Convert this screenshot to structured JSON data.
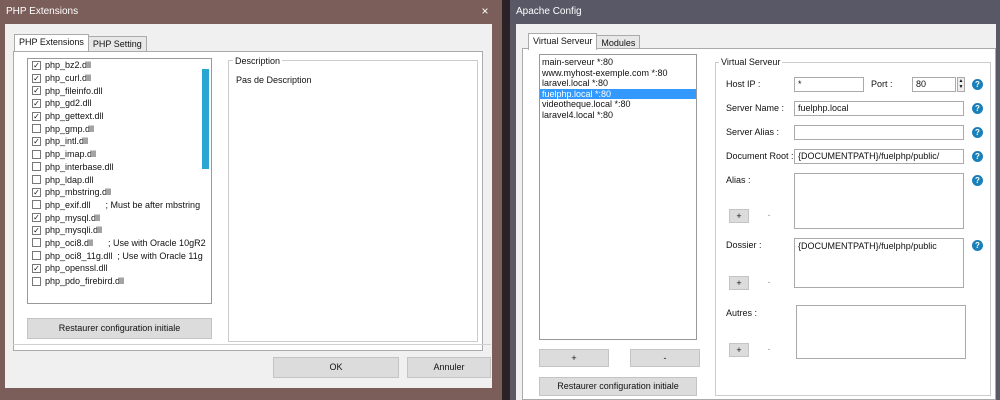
{
  "left_window": {
    "title": "PHP Extensions",
    "close_glyph": "×",
    "tabs": [
      {
        "label": "PHP Extensions",
        "active": true
      },
      {
        "label": "PHP Setting",
        "active": false
      }
    ],
    "extensions": [
      {
        "name": "php_bz2.dll",
        "checked": true
      },
      {
        "name": "php_curl.dll",
        "checked": true
      },
      {
        "name": "php_fileinfo.dll",
        "checked": true
      },
      {
        "name": "php_gd2.dll",
        "checked": true
      },
      {
        "name": "php_gettext.dll",
        "checked": true
      },
      {
        "name": "php_gmp.dll",
        "checked": false
      },
      {
        "name": "php_intl.dll",
        "checked": true
      },
      {
        "name": "php_imap.dll",
        "checked": false
      },
      {
        "name": "php_interbase.dll",
        "checked": false
      },
      {
        "name": "php_ldap.dll",
        "checked": false
      },
      {
        "name": "php_mbstring.dll",
        "checked": true
      },
      {
        "name": "php_exif.dll      ; Must be after mbstring",
        "checked": false
      },
      {
        "name": "php_mysql.dll",
        "checked": true
      },
      {
        "name": "php_mysqli.dll",
        "checked": true
      },
      {
        "name": "php_oci8.dll      ; Use with Oracle 10gR2",
        "checked": false
      },
      {
        "name": "php_oci8_11g.dll  ; Use with Oracle 11g",
        "checked": false
      },
      {
        "name": "php_openssl.dll",
        "checked": true
      },
      {
        "name": "php_pdo_firebird.dll",
        "checked": false
      }
    ],
    "description_label": "Description",
    "description_text": "Pas de Description",
    "restore_button": "Restaurer configuration initiale",
    "ok_button": "OK",
    "cancel_button": "Annuler"
  },
  "right_window": {
    "title": "Apache Config",
    "tabs": [
      {
        "label": "Virtual Serveur",
        "active": true
      },
      {
        "label": "Modules",
        "active": false
      }
    ],
    "vhosts": [
      {
        "label": "main-serveur *:80",
        "selected": false
      },
      {
        "label": "www.myhost-exemple.com *:80",
        "selected": false
      },
      {
        "label": "laravel.local *:80",
        "selected": false
      },
      {
        "label": "fuelphp.local *:80",
        "selected": true
      },
      {
        "label": "videotheque.local *:80",
        "selected": false
      },
      {
        "label": "laravel4.local *:80",
        "selected": false
      }
    ],
    "add_button": "+",
    "remove_button": "-",
    "restore_button": "Restaurer configuration initiale",
    "group_label": "Virtual Serveur",
    "host_ip_label": "Host IP :",
    "host_ip_value": "*",
    "port_label": "Port :",
    "port_value": "80",
    "server_name_label": "Server Name :",
    "server_name_value": "fuelphp.local",
    "server_alias_label": "Server Alias :",
    "server_alias_value": "",
    "document_root_label": "Document Root :",
    "document_root_value": "{DOCUMENTPATH}/fuelphp/public/",
    "alias_label": "Alias :",
    "alias_value": "",
    "dossier_label": "Dossier :",
    "dossier_value": "{DOCUMENTPATH}/fuelphp/public",
    "autres_label": "Autres :",
    "autres_value": "",
    "help_glyph": "?",
    "mini_add": "+",
    "mini_remove": "-"
  },
  "colors": {
    "selection": "#3399ff",
    "accent_scroll": "#2ba6d3",
    "help_icon": "#1b7fb8"
  }
}
